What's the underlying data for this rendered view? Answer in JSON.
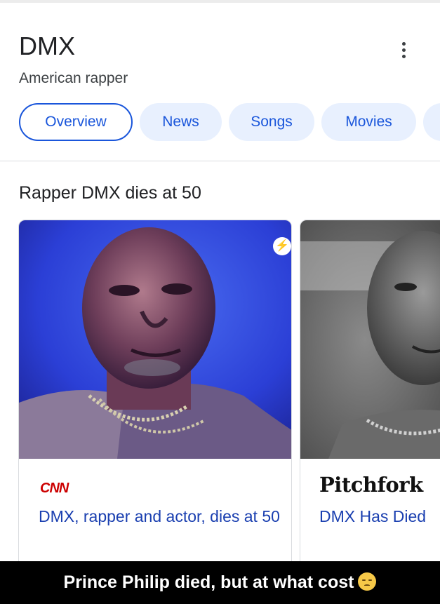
{
  "header": {
    "title": "DMX",
    "subtitle": "American rapper"
  },
  "tabs": [
    {
      "label": "Overview",
      "active": true
    },
    {
      "label": "News",
      "active": false
    },
    {
      "label": "Songs",
      "active": false
    },
    {
      "label": "Movies",
      "active": false
    }
  ],
  "section": {
    "title": "Rapper DMX dies at 50"
  },
  "articles": [
    {
      "source": "CNN",
      "headline": "DMX, rapper and actor, dies at 50",
      "badge_icon": "amp-lightning-icon"
    },
    {
      "source": "Pitchfork",
      "headline": "DMX Has Died"
    }
  ],
  "caption": {
    "text": "Prince Philip died, but at what cost",
    "emoji_icon": "pensive-face-icon"
  },
  "colors": {
    "accent": "#1a56db",
    "chip_bg": "#e8f0fe",
    "link": "#1a3fb0",
    "cnn_red": "#cc0000"
  }
}
